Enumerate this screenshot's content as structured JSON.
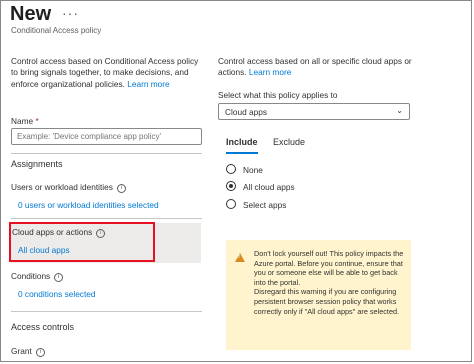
{
  "header": {
    "title": "New",
    "ellipsis": "···",
    "subtitle": "Conditional Access policy"
  },
  "left": {
    "intro": {
      "text": "Control access based on Conditional Access policy to bring signals together, to make decisions, and enforce organizational policies.",
      "link": "Learn more"
    },
    "name_label": "Name",
    "name_required": "*",
    "name_placeholder": "Example: 'Device compliance app policy'",
    "assignments_heading": "Assignments",
    "users": {
      "label": "Users or workload identities",
      "value": "0 users or workload identities selected"
    },
    "cloud_apps": {
      "label": "Cloud apps or actions",
      "value": "All cloud apps"
    },
    "conditions": {
      "label": "Conditions",
      "value": "0 conditions selected"
    },
    "access_controls_heading": "Access controls",
    "grant_label": "Grant"
  },
  "right": {
    "intro": {
      "text": "Control access based on all or specific cloud apps or actions.",
      "link": "Learn more"
    },
    "select_label": "Select what this policy applies to",
    "select_value": "Cloud apps",
    "tabs": [
      {
        "label": "Include"
      },
      {
        "label": "Exclude"
      }
    ],
    "options": [
      {
        "label": "None",
        "checked": false
      },
      {
        "label": "All cloud apps",
        "checked": true
      },
      {
        "label": "Select apps",
        "checked": false
      }
    ],
    "warning": {
      "text": "Don't lock yourself out! This policy impacts the Azure portal. Before you continue, ensure that you or someone else will be able to get back into the portal.",
      "text2": "Disregard this warning if you are configuring persistent browser session policy that works correctly only if \"All cloud apps\" are selected."
    }
  },
  "colors": {
    "accent": "#0078d4",
    "highlight_border": "#e81123",
    "warning_bg": "#fff4ce",
    "warning_icon": "#d98b1f"
  }
}
